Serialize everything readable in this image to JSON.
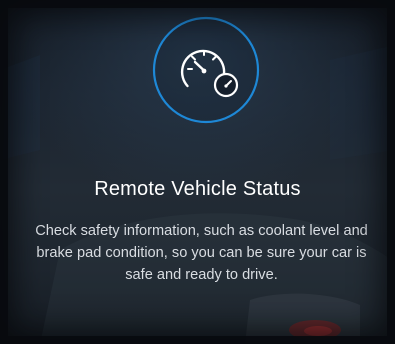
{
  "feature": {
    "icon": "speedometer-gauge-icon",
    "accent_color": "#1e88d6",
    "title": "Remote Vehicle Status",
    "description": "Check safety information, such as coolant level and brake pad condition, so you can be sure your car is safe and ready to drive."
  }
}
